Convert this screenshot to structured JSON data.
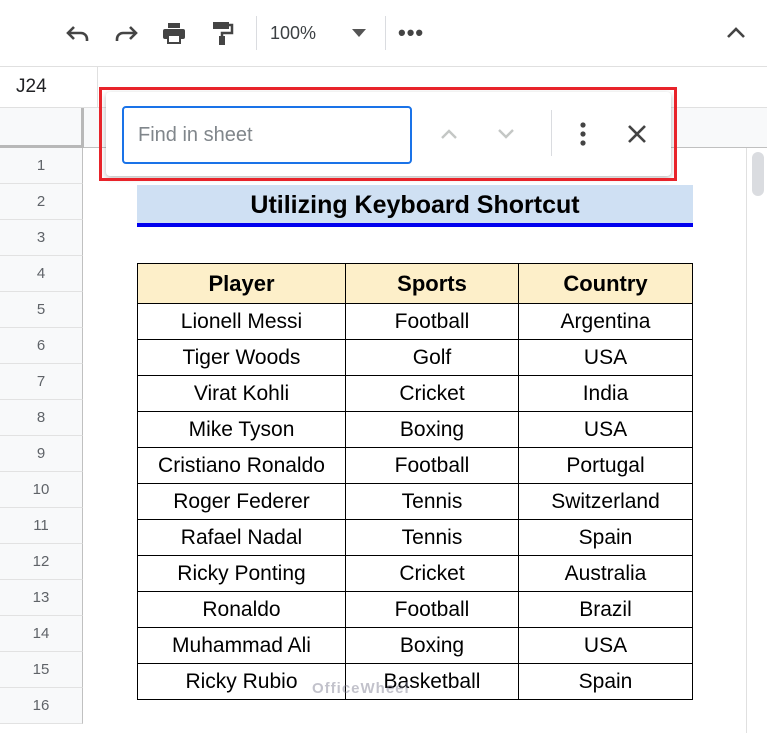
{
  "toolbar": {
    "zoom_value": "100%",
    "icons": [
      "undo-icon",
      "redo-icon",
      "print-icon",
      "paint-format-icon",
      "more-icon",
      "collapse-icon"
    ]
  },
  "namebox": {
    "value": "J24"
  },
  "find": {
    "placeholder": "Find in sheet",
    "value": ""
  },
  "rows": [
    "1",
    "2",
    "3",
    "4",
    "5",
    "6",
    "7",
    "8",
    "9",
    "10",
    "11",
    "12",
    "13",
    "14",
    "15",
    "16"
  ],
  "sheet": {
    "title": "Utilizing Keyboard Shortcut",
    "headers": [
      "Player",
      "Sports",
      "Country"
    ],
    "records": [
      [
        "Lionell Messi",
        "Football",
        "Argentina"
      ],
      [
        "Tiger Woods",
        "Golf",
        "USA"
      ],
      [
        "Virat Kohli",
        "Cricket",
        "India"
      ],
      [
        "Mike Tyson",
        "Boxing",
        "USA"
      ],
      [
        "Cristiano Ronaldo",
        "Football",
        "Portugal"
      ],
      [
        "Roger Federer",
        "Tennis",
        "Switzerland"
      ],
      [
        "Rafael Nadal",
        "Tennis",
        "Spain"
      ],
      [
        "Ricky Ponting",
        "Cricket",
        "Australia"
      ],
      [
        "Ronaldo",
        "Football",
        "Brazil"
      ],
      [
        "Muhammad Ali",
        "Boxing",
        "USA"
      ],
      [
        "Ricky Rubio",
        "Basketball",
        "Spain"
      ]
    ]
  },
  "watermark": "OfficeWheel",
  "colors": {
    "accent": "#1a73e8",
    "highlight_border": "#e8232a",
    "title_fill": "#cfe0f3",
    "header_fill": "#fdefc9",
    "title_underline": "#0000ee"
  }
}
